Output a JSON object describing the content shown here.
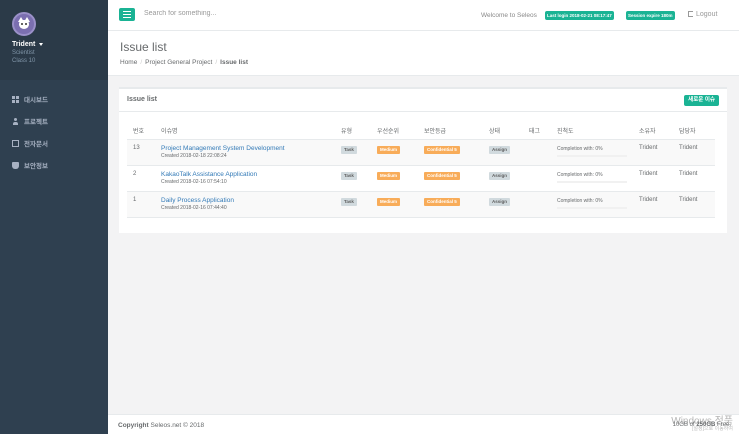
{
  "sidebar": {
    "profile": {
      "name": "Trident",
      "role": "Scientist",
      "class": "Class 10"
    },
    "items": [
      {
        "label": "대시보드",
        "icon": "dashboard-icon"
      },
      {
        "label": "프로젝트",
        "icon": "user-icon"
      },
      {
        "label": "전자문서",
        "icon": "document-icon"
      },
      {
        "label": "보안정보",
        "icon": "shield-icon"
      }
    ]
  },
  "topbar": {
    "search_placeholder": "Search for something...",
    "welcome": "Welcome to Seleos",
    "last_login": "Last login 2018-02-21 08:17:47",
    "session_expire": "Session expire 180m",
    "logout": "Logout"
  },
  "heading": {
    "title": "Issue list",
    "breadcrumb": [
      "Home",
      "Project General Project",
      "Issue list"
    ]
  },
  "panel": {
    "title": "Issue list",
    "new_button": "새로운 이슈",
    "columns": [
      "번호",
      "이슈명",
      "유형",
      "우선순위",
      "보안등급",
      "상태",
      "태그",
      "진척도",
      "소유자",
      "담당자"
    ],
    "rows": [
      {
        "number": "13",
        "title": "Project Management System Development",
        "created": "Created 2018-02-18 22:08:24",
        "type": "Task",
        "priority": "Medium",
        "security": "Confidential 5",
        "status": "Assign",
        "tag": "",
        "progress_text": "Completion with: 0%",
        "progress": 0,
        "owner": "Trident",
        "assignee": "Trident"
      },
      {
        "number": "2",
        "title": "KakaoTalk Assistance Application",
        "created": "Created 2018-02-16 07:54:10",
        "type": "Task",
        "priority": "Medium",
        "security": "Confidential 5",
        "status": "Assign",
        "tag": "",
        "progress_text": "Completion with: 0%",
        "progress": 0,
        "owner": "Trident",
        "assignee": "Trident"
      },
      {
        "number": "1",
        "title": "Daily Process Application",
        "created": "Created 2018-02-16 07:44:40",
        "type": "Task",
        "priority": "Medium",
        "security": "Confidential 5",
        "status": "Assign",
        "tag": "",
        "progress_text": "Completion with: 0%",
        "progress": 0,
        "owner": "Trident",
        "assignee": "Trident"
      }
    ]
  },
  "footer": {
    "copyright_bold": "Copyright",
    "copyright_rest": " Seleos.net © 2018",
    "storage_used": "10GB",
    "storage_of": " of ",
    "storage_total": "250GB",
    "storage_free": " Free."
  },
  "watermark": {
    "title": "Windows 정품",
    "subtitle": "[설정]으로 이동하여"
  },
  "colors": {
    "accent": "#1ab394",
    "sidebar": "#2f4050",
    "warning": "#f8ac59",
    "link": "#337ab7"
  }
}
